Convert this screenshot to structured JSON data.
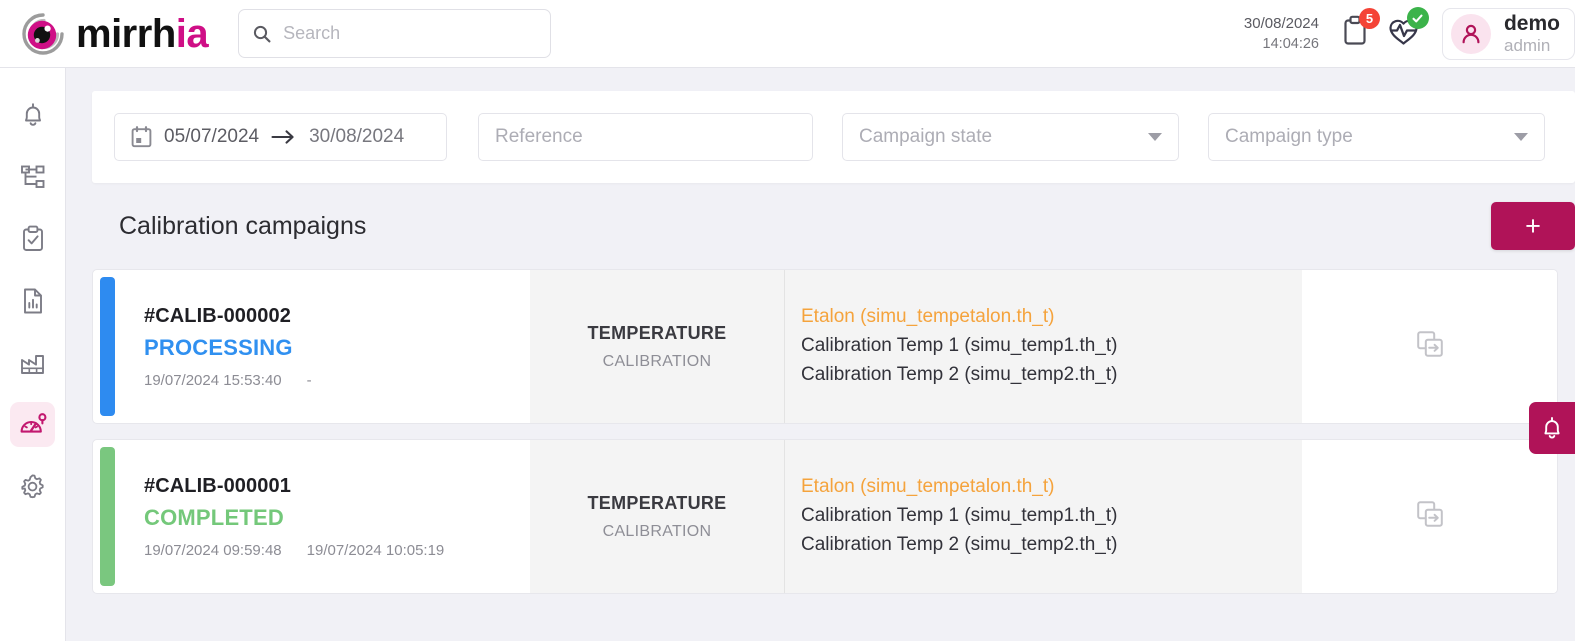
{
  "brand": {
    "name_prefix": "mirrh",
    "name_accent": "ia",
    "accent_color": "#cf0f86"
  },
  "header": {
    "search_placeholder": "Search",
    "search_value": "",
    "date": "30/08/2024",
    "time": "14:04:26",
    "notifications_badge": "5",
    "user_name": "demo",
    "user_role": "admin"
  },
  "sidebar": {
    "items": [
      {
        "name": "alerts",
        "icon": "bell-icon",
        "active": false
      },
      {
        "name": "structure",
        "icon": "sitemap-icon",
        "active": false
      },
      {
        "name": "tasks",
        "icon": "clipboard-check-icon",
        "active": false
      },
      {
        "name": "reports",
        "icon": "document-chart-icon",
        "active": false
      },
      {
        "name": "plants",
        "icon": "factory-icon",
        "active": false
      },
      {
        "name": "calibration",
        "icon": "gauge-pin-icon",
        "active": true
      },
      {
        "name": "settings",
        "icon": "gear-icon",
        "active": false
      }
    ]
  },
  "filters": {
    "date_from": "05/07/2024",
    "date_to": "30/08/2024",
    "reference_placeholder": "Reference",
    "reference_value": "",
    "campaign_state_placeholder": "Campaign state",
    "campaign_type_placeholder": "Campaign type"
  },
  "section": {
    "title": "Calibration campaigns",
    "add_label": "+"
  },
  "campaigns": [
    {
      "reference": "#CALIB-000002",
      "state": "PROCESSING",
      "state_color": "#3090f0",
      "accent_color": "#2e8bf0",
      "start_date": "19/07/2024 15:53:40",
      "end_date": "-",
      "type_main": "TEMPERATURE",
      "type_sub": "CALIBRATION",
      "sensors": [
        {
          "label": "Etalon (simu_tempetalon.th_t)",
          "etalon": true
        },
        {
          "label": "Calibration Temp 1 (simu_temp1.th_t)",
          "etalon": false
        },
        {
          "label": "Calibration Temp 2 (simu_temp2.th_t)",
          "etalon": false
        }
      ]
    },
    {
      "reference": "#CALIB-000001",
      "state": "COMPLETED",
      "state_color": "#74c87a",
      "accent_color": "#7ac77f",
      "start_date": "19/07/2024 09:59:48",
      "end_date": "19/07/2024 10:05:19",
      "type_main": "TEMPERATURE",
      "type_sub": "CALIBRATION",
      "sensors": [
        {
          "label": "Etalon (simu_tempetalon.th_t)",
          "etalon": true
        },
        {
          "label": "Calibration Temp 1 (simu_temp1.th_t)",
          "etalon": false
        },
        {
          "label": "Calibration Temp 2 (simu_temp2.th_t)",
          "etalon": false
        }
      ]
    }
  ]
}
